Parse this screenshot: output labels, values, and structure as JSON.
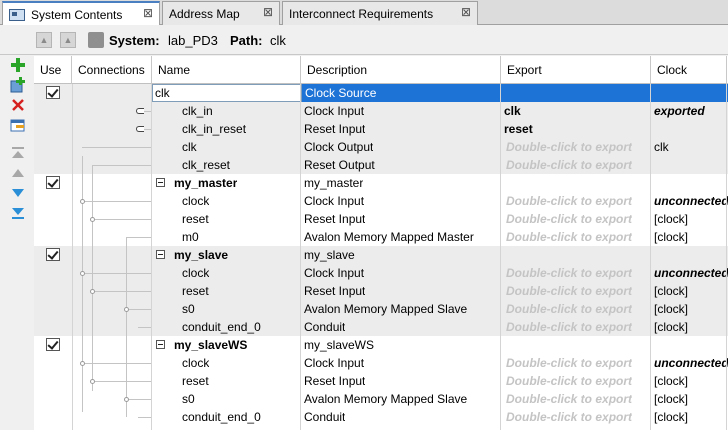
{
  "tabs": [
    {
      "label": "System Contents",
      "close": "⊠"
    },
    {
      "label": "Address Map",
      "close": "⊠"
    },
    {
      "label": "Interconnect Requirements",
      "close": "⊠"
    }
  ],
  "toolbar": {
    "system_label": "System:",
    "system_value": "lab_PD3",
    "path_label": "Path:",
    "path_value": "clk"
  },
  "columns": {
    "use": "Use",
    "connections": "Connections",
    "name": "Name",
    "description": "Description",
    "export": "Export",
    "clock": "Clock"
  },
  "rows": [
    {
      "name": "clk",
      "description": "Clock Source",
      "export": "",
      "clock": ""
    },
    {
      "name": "clk_in",
      "description": "Clock Input",
      "export": "clk",
      "clock": "exported"
    },
    {
      "name": "clk_in_reset",
      "description": "Reset Input",
      "export": "reset",
      "clock": ""
    },
    {
      "name": "clk",
      "description": "Clock Output",
      "export": "Double-click to export",
      "clock": "clk"
    },
    {
      "name": "clk_reset",
      "description": "Reset Output",
      "export": "Double-click to export",
      "clock": ""
    },
    {
      "name": "my_master",
      "description": "my_master",
      "export": "",
      "clock": ""
    },
    {
      "name": "clock",
      "description": "Clock Input",
      "export": "Double-click to export",
      "clock": "unconnected"
    },
    {
      "name": "reset",
      "description": "Reset Input",
      "export": "Double-click to export",
      "clock": "[clock]"
    },
    {
      "name": "m0",
      "description": "Avalon Memory Mapped Master",
      "export": "Double-click to export",
      "clock": "[clock]"
    },
    {
      "name": "my_slave",
      "description": "my_slave",
      "export": "",
      "clock": ""
    },
    {
      "name": "clock",
      "description": "Clock Input",
      "export": "Double-click to export",
      "clock": "unconnected"
    },
    {
      "name": "reset",
      "description": "Reset Input",
      "export": "Double-click to export",
      "clock": "[clock]"
    },
    {
      "name": "s0",
      "description": "Avalon Memory Mapped Slave",
      "export": "Double-click to export",
      "clock": "[clock]"
    },
    {
      "name": "conduit_end_0",
      "description": "Conduit",
      "export": "Double-click to export",
      "clock": "[clock]"
    },
    {
      "name": "my_slaveWS",
      "description": "my_slaveWS",
      "export": "",
      "clock": ""
    },
    {
      "name": "clock",
      "description": "Clock Input",
      "export": "Double-click to export",
      "clock": "unconnected"
    },
    {
      "name": "reset",
      "description": "Reset Input",
      "export": "Double-click to export",
      "clock": "[clock]"
    },
    {
      "name": "s0",
      "description": "Avalon Memory Mapped Slave",
      "export": "Double-click to export",
      "clock": "[clock]"
    },
    {
      "name": "conduit_end_0",
      "description": "Conduit",
      "export": "Double-click to export",
      "clock": "[clock]"
    }
  ],
  "colors": {
    "selection": "#1e73d6",
    "hint_text": "#c4c4c4",
    "add": "#2aa52a",
    "remove": "#d62020",
    "arrow": "#2a8fd6"
  },
  "icons": [
    "add-icon",
    "add-component-icon",
    "remove-icon",
    "edit-icon",
    "move-top-icon",
    "move-up-icon",
    "move-down-icon",
    "move-bottom-icon"
  ]
}
